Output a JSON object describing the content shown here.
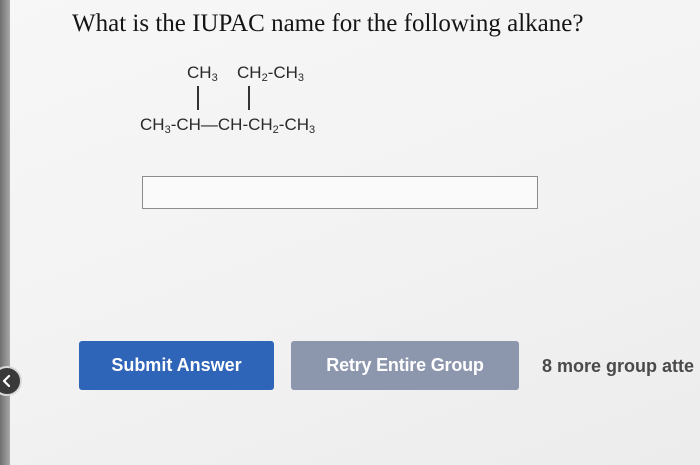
{
  "question": {
    "text": "What is the IUPAC name for the following alkane?"
  },
  "structure": {
    "top_left": {
      "main": "CH",
      "sub": "3"
    },
    "top_right_a": {
      "main": "CH",
      "sub": "2"
    },
    "top_right_b": {
      "main": "-CH",
      "sub": "3"
    },
    "chain": [
      {
        "main": "CH",
        "sub": "3"
      },
      {
        "main": "-CH—CH-CH",
        "sub": "2"
      },
      {
        "main": "-CH",
        "sub": "3"
      }
    ]
  },
  "answer": {
    "value": "",
    "placeholder": ""
  },
  "buttons": {
    "submit": "Submit Answer",
    "retry": "Retry Entire Group"
  },
  "attempts": {
    "text": "8 more group atte"
  },
  "icons": {
    "back": "back-arrow-icon"
  },
  "colors": {
    "submit_bg": "#2f65b8",
    "retry_bg": "#8c96ad"
  }
}
